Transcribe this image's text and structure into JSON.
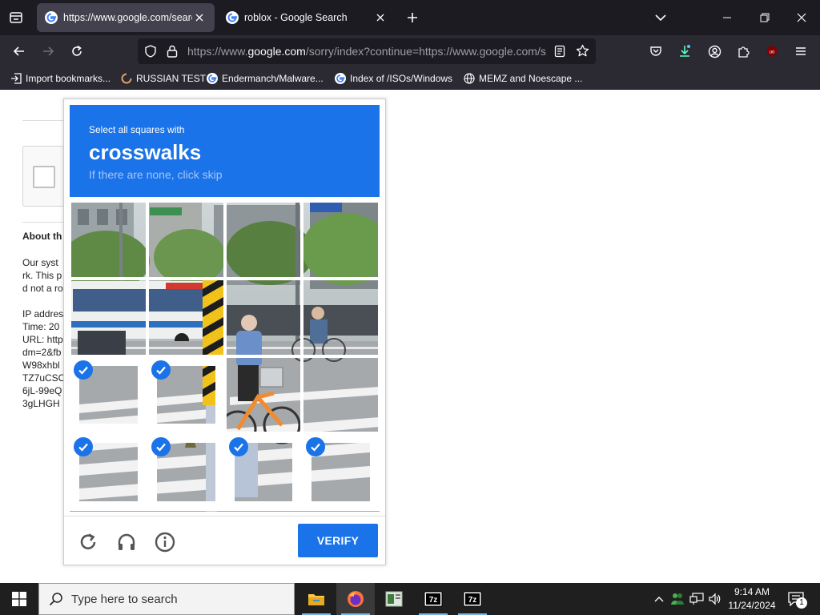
{
  "browser": {
    "tabs": [
      {
        "title": "https://www.google.com/searc",
        "active": true
      },
      {
        "title": "roblox - Google Search",
        "active": false
      }
    ],
    "url": {
      "prefix": "https://www.",
      "host": "google.com",
      "rest": "/sorry/index?continue=https://www.google.com/s"
    },
    "bookmarks": [
      {
        "label": "Import bookmarks...",
        "icon": "import-icon"
      },
      {
        "label": "RUSSIAN TEST",
        "icon": "spinner-icon"
      },
      {
        "label": "Endermanch/Malware...",
        "icon": "google-icon"
      },
      {
        "label": "Index of /ISOs/Windows",
        "icon": "google-icon"
      },
      {
        "label": "MEMZ and Noescape ...",
        "icon": "globe-icon"
      }
    ]
  },
  "background_page": {
    "heading": "About th",
    "paragraph": [
      "Our syst",
      "rk. This p",
      "d not a ro"
    ],
    "details": [
      "IP addres",
      "Time: 20",
      "URL: http",
      "dm=2&fb",
      "W98xhbl",
      "TZ7uCSC",
      "6jL-99eQ",
      "3gLHGH"
    ]
  },
  "captcha": {
    "instruction": "Select all squares with",
    "target": "crosswalks",
    "hint": "If there are none, click skip",
    "selected": [
      [
        false,
        false,
        false,
        false
      ],
      [
        false,
        false,
        false,
        false
      ],
      [
        true,
        true,
        false,
        false
      ],
      [
        true,
        true,
        true,
        true
      ]
    ],
    "verify_label": "VERIFY",
    "accent": "#1a73e8"
  },
  "taskbar": {
    "search_placeholder": "Type here to search",
    "time": "9:14 AM",
    "date": "11/24/2024",
    "notification_count": "1"
  }
}
